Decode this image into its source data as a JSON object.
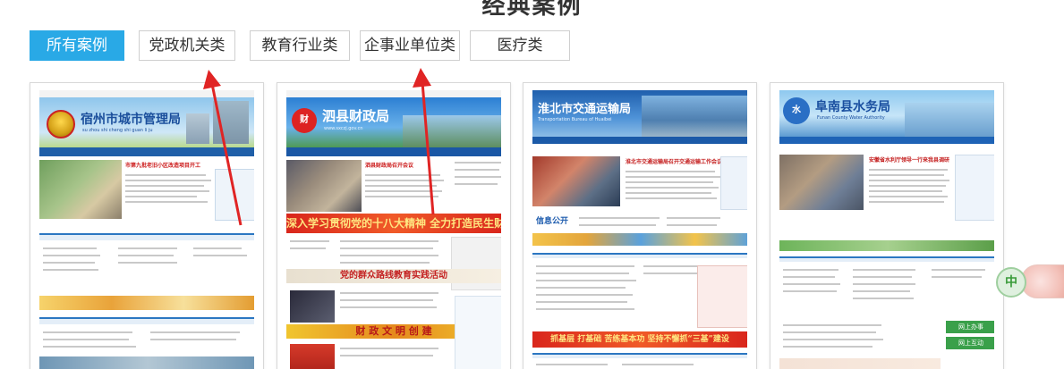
{
  "section": {
    "title": "经典案例"
  },
  "tabs": [
    {
      "label": "所有案例",
      "active": true
    },
    {
      "label": "党政机关类",
      "active": false
    },
    {
      "label": "教育行业类",
      "active": false
    },
    {
      "label": "企事业单位类",
      "active": false
    },
    {
      "label": "医疗类",
      "active": false
    }
  ],
  "cases": [
    {
      "site_name": "宿州市城市管理局",
      "site_pinyin": "su zhou shi cheng shi guan li ju",
      "banner_color": "#2f7fc4",
      "news_headline": "市第九批老旧小区改造项目开工",
      "strip_text": ""
    },
    {
      "site_name": "泗县财政局",
      "site_pinyin": "www.sxczj.gov.cn",
      "banner_color": "#3a8fd6",
      "news_headline": "泗县财政局召开会议",
      "strip_text": "深入学习贯彻党的十八大精神  全力打造民生财政",
      "strip2_text": "党的群众路线教育实践活动",
      "strip3_text": "财 政 文 明 创 建"
    },
    {
      "site_name": "淮北市交通运输局",
      "site_pinyin": "Transportation Bureau of Huaibei",
      "banner_color": "#3d7fc7",
      "news_headline": "淮北市交通运输局召开交通运输工作会议",
      "strip_text": "抓基层 打基础 苦练基本功 坚持不懈抓“三基”建设",
      "info_label": "信息公开"
    },
    {
      "site_name": "阜南县水务局",
      "site_pinyin": "Funan County Water Authority",
      "banner_color": "#2e7fd1",
      "news_headline": "安徽省水利厅领导一行来我县调研",
      "strip_text": "",
      "side_buttons": [
        "网上办事",
        "网上互动"
      ]
    }
  ],
  "float_widget": {
    "char": "中"
  },
  "colors": {
    "accent": "#29a9e6",
    "arrow": "#e02424"
  }
}
